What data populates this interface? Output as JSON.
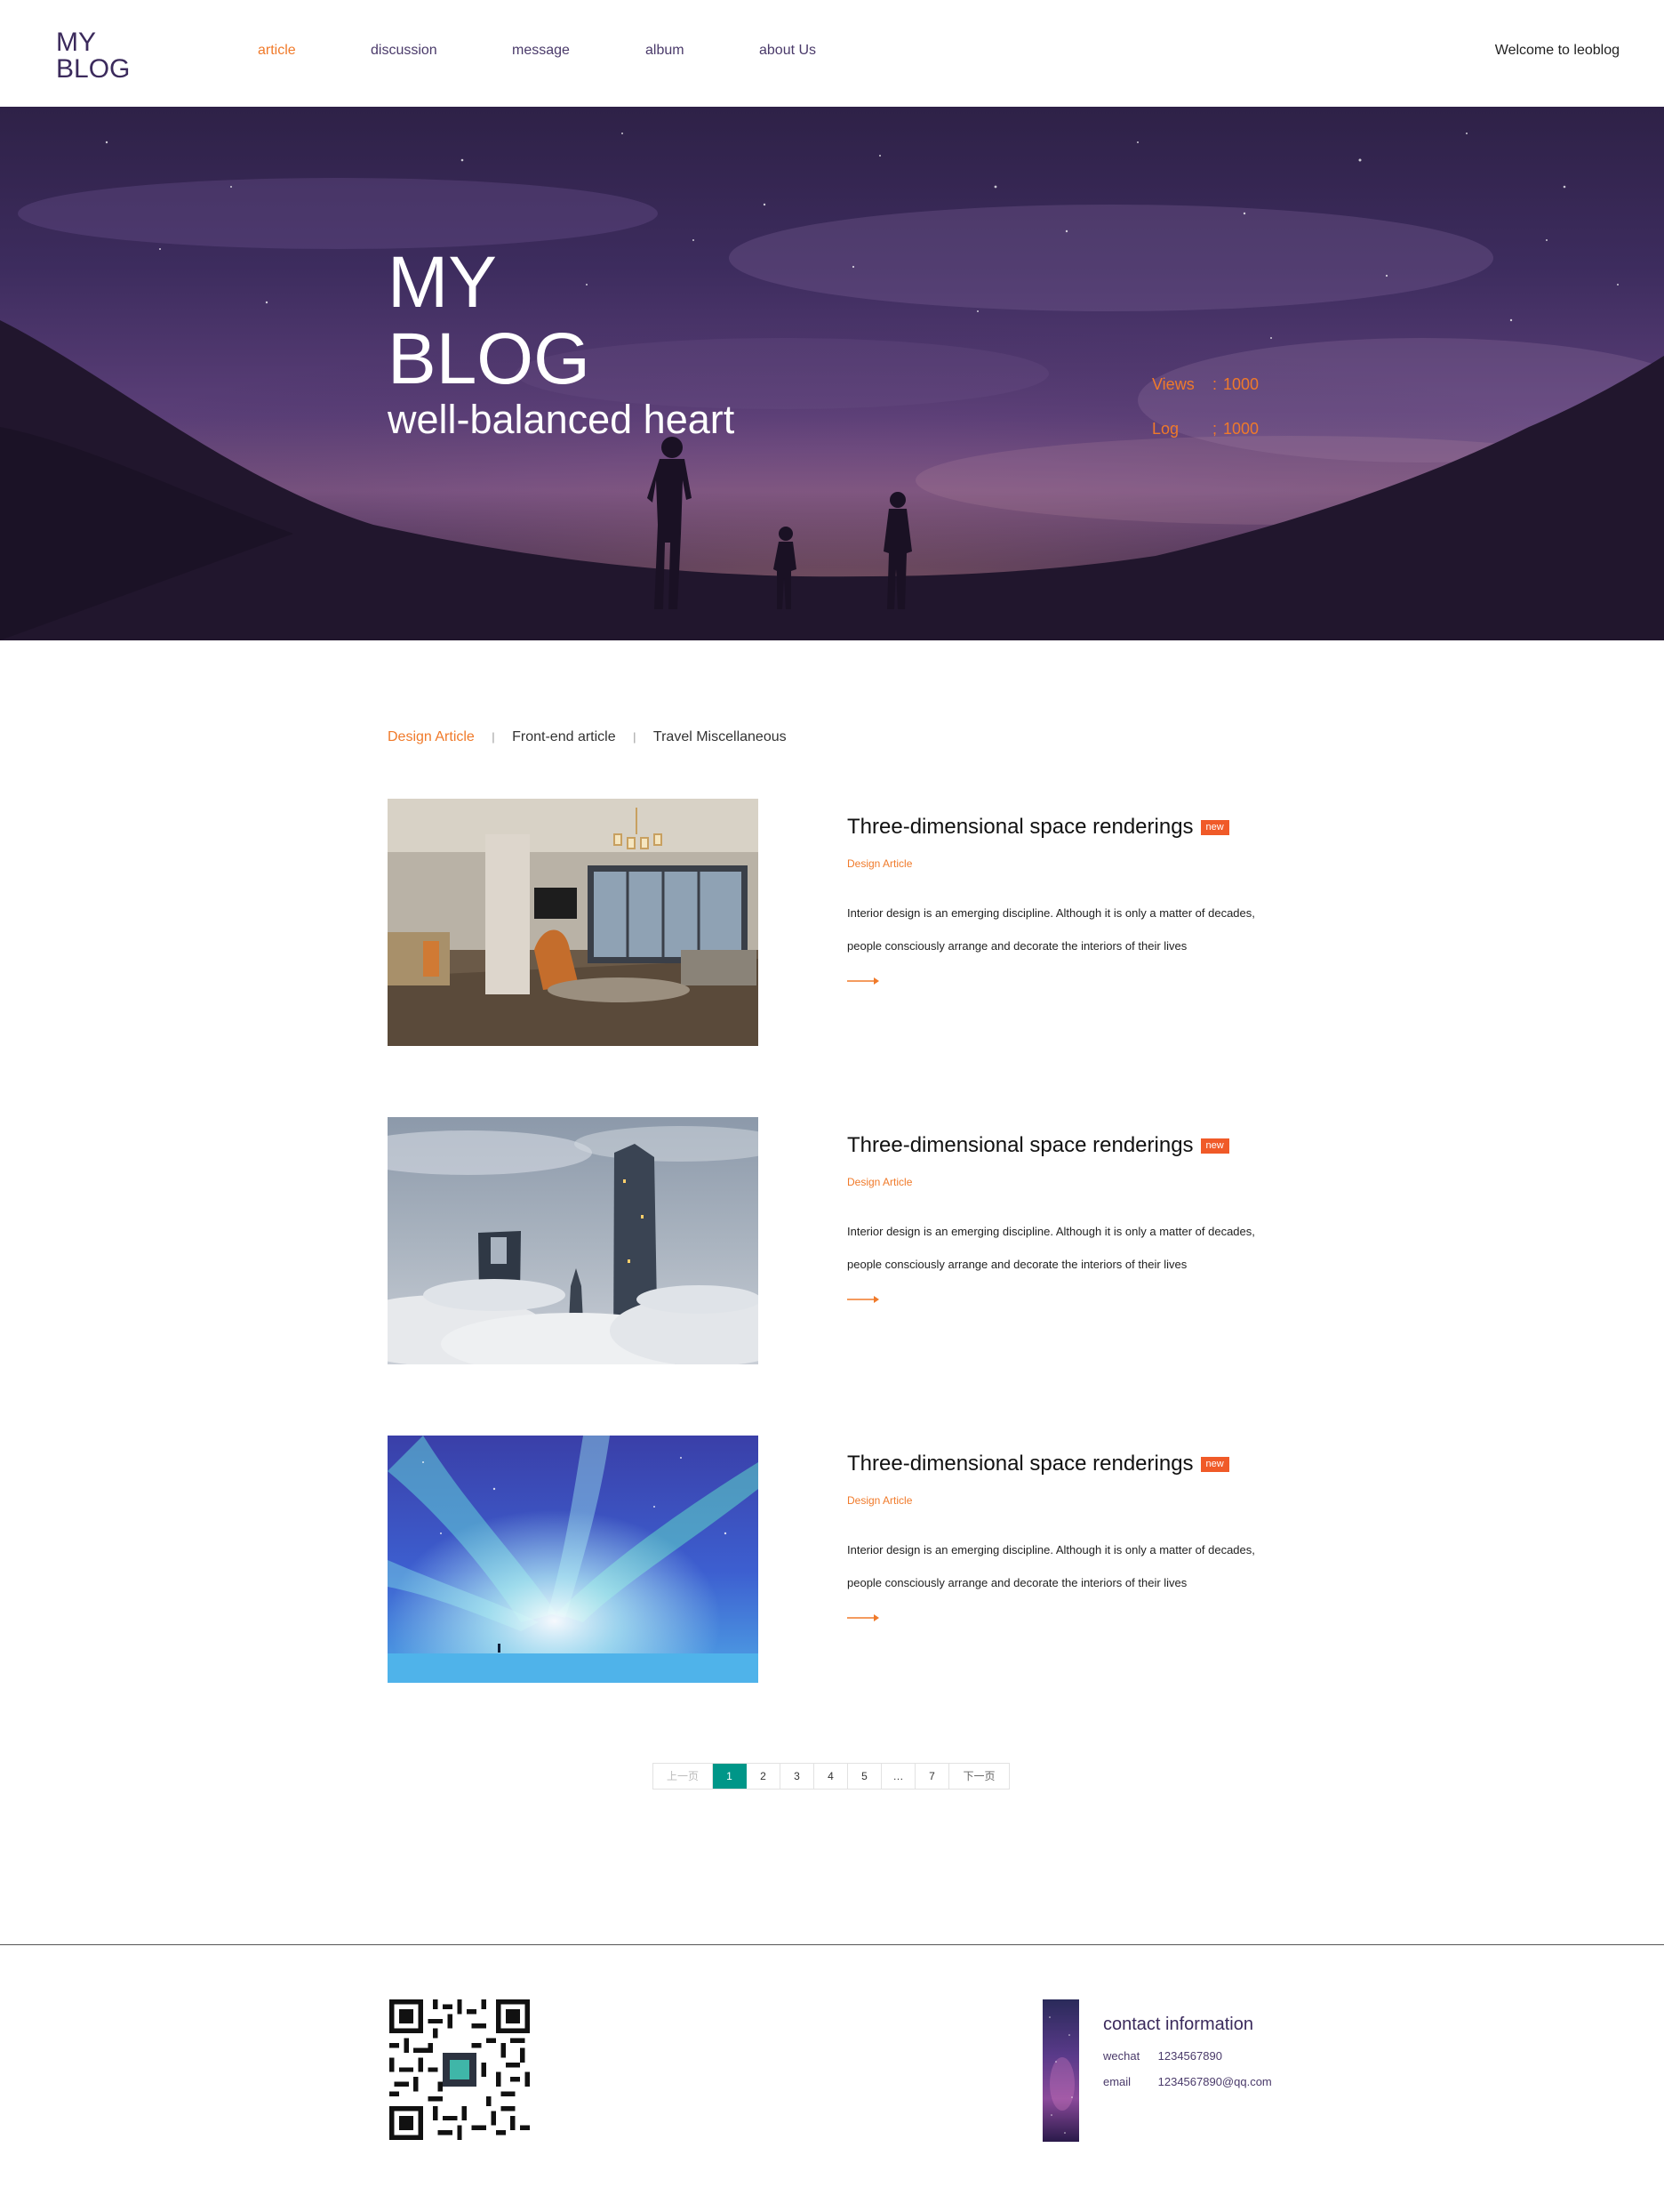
{
  "header": {
    "logo_line1": "MY",
    "logo_line2": "BLOG",
    "nav": [
      {
        "label": "article",
        "active": true
      },
      {
        "label": "discussion",
        "active": false
      },
      {
        "label": "message",
        "active": false
      },
      {
        "label": "album",
        "active": false
      },
      {
        "label": "about Us",
        "active": false
      }
    ],
    "welcome": "Welcome to leoblog"
  },
  "hero": {
    "title_line1": "MY",
    "title_line2": "BLOG",
    "subtitle": "well-balanced heart",
    "stats": [
      {
        "label": "Views",
        "sep": ":",
        "value": "1000"
      },
      {
        "label": "Log",
        "sep": ";",
        "value": "1000"
      }
    ]
  },
  "categories": {
    "tabs": [
      "Design Article",
      "Front-end article",
      "Travel Miscellaneous"
    ],
    "separator": "|",
    "active": "Design Article"
  },
  "articles": [
    {
      "image": "interior-living-room",
      "title": "Three-dimensional space renderings",
      "badge": "new",
      "category": "Design Article",
      "description": "Interior design is an emerging discipline. Although it is only a matter of decades, people consciously arrange and decorate the interiors of their lives"
    },
    {
      "image": "skyscrapers-above-clouds",
      "title": "Three-dimensional space renderings",
      "badge": "new",
      "category": "Design Article",
      "description": "Interior design is an emerging discipline. Although it is only a matter of decades, people consciously arrange and decorate the interiors of their lives"
    },
    {
      "image": "aurora-night-sky",
      "title": "Three-dimensional space renderings",
      "badge": "new",
      "category": "Design Article",
      "description": "Interior design is an emerging discipline. Although it is only a matter of decades, people consciously arrange and decorate the interiors of their lives"
    }
  ],
  "pagination": {
    "prev": "上一页",
    "pages": [
      "1",
      "2",
      "3",
      "4",
      "5",
      "…",
      "7"
    ],
    "current": "1",
    "next": "下一页"
  },
  "footer": {
    "contact_title": "contact information",
    "wechat_label": "wechat",
    "wechat_value": "1234567890",
    "email_label": "email",
    "email_value": "1234567890@qq.com"
  },
  "colors": {
    "accent": "#f07a2a",
    "badge": "#f05a28",
    "pager_active": "#009688",
    "brand_purple": "#3b2a5c"
  }
}
